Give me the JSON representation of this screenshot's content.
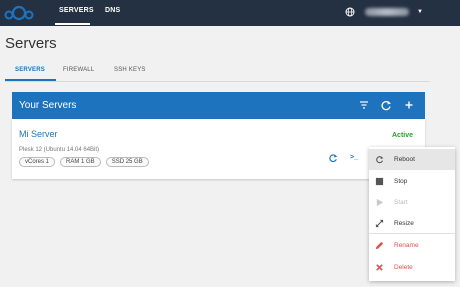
{
  "nav": {
    "servers_label": "SERVERS",
    "dns_label": "DNS"
  },
  "page": {
    "title": "Servers"
  },
  "tabs": [
    {
      "label": "SERVERS"
    },
    {
      "label": "FIREWALL"
    },
    {
      "label": "SSH KEYS"
    }
  ],
  "card": {
    "title": "Your Servers",
    "server": {
      "name": "Mi Server",
      "os": "Plesk 12 (Ubuntu 14.04 64Bit)",
      "specs": [
        "vCores 1",
        "RAM 1 GB",
        "SSD 25 GB"
      ],
      "status": "Active"
    }
  },
  "menu": {
    "items": [
      {
        "label": "Reboot",
        "icon": "refresh-icon"
      },
      {
        "label": "Stop",
        "icon": "stop-icon"
      },
      {
        "label": "Start",
        "icon": "play-icon"
      },
      {
        "label": "Resize",
        "icon": "resize-icon"
      },
      {
        "label": "Rename",
        "icon": "pencil-icon"
      },
      {
        "label": "Delete",
        "icon": "x-icon"
      }
    ]
  },
  "colors": {
    "topbar": "#243142",
    "accent": "#1e73be",
    "active": "#2ca02c",
    "danger": "#d9534f"
  }
}
